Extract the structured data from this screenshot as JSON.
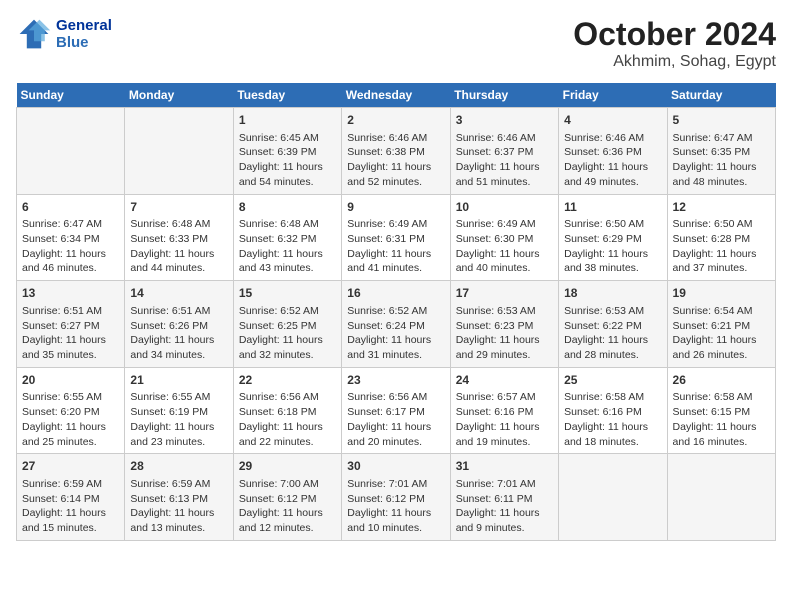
{
  "header": {
    "logo_line1": "General",
    "logo_line2": "Blue",
    "month": "October 2024",
    "location": "Akhmim, Sohag, Egypt"
  },
  "days_of_week": [
    "Sunday",
    "Monday",
    "Tuesday",
    "Wednesday",
    "Thursday",
    "Friday",
    "Saturday"
  ],
  "weeks": [
    [
      {
        "day": "",
        "content": ""
      },
      {
        "day": "",
        "content": ""
      },
      {
        "day": "1",
        "content": "Sunrise: 6:45 AM\nSunset: 6:39 PM\nDaylight: 11 hours and 54 minutes."
      },
      {
        "day": "2",
        "content": "Sunrise: 6:46 AM\nSunset: 6:38 PM\nDaylight: 11 hours and 52 minutes."
      },
      {
        "day": "3",
        "content": "Sunrise: 6:46 AM\nSunset: 6:37 PM\nDaylight: 11 hours and 51 minutes."
      },
      {
        "day": "4",
        "content": "Sunrise: 6:46 AM\nSunset: 6:36 PM\nDaylight: 11 hours and 49 minutes."
      },
      {
        "day": "5",
        "content": "Sunrise: 6:47 AM\nSunset: 6:35 PM\nDaylight: 11 hours and 48 minutes."
      }
    ],
    [
      {
        "day": "6",
        "content": "Sunrise: 6:47 AM\nSunset: 6:34 PM\nDaylight: 11 hours and 46 minutes."
      },
      {
        "day": "7",
        "content": "Sunrise: 6:48 AM\nSunset: 6:33 PM\nDaylight: 11 hours and 44 minutes."
      },
      {
        "day": "8",
        "content": "Sunrise: 6:48 AM\nSunset: 6:32 PM\nDaylight: 11 hours and 43 minutes."
      },
      {
        "day": "9",
        "content": "Sunrise: 6:49 AM\nSunset: 6:31 PM\nDaylight: 11 hours and 41 minutes."
      },
      {
        "day": "10",
        "content": "Sunrise: 6:49 AM\nSunset: 6:30 PM\nDaylight: 11 hours and 40 minutes."
      },
      {
        "day": "11",
        "content": "Sunrise: 6:50 AM\nSunset: 6:29 PM\nDaylight: 11 hours and 38 minutes."
      },
      {
        "day": "12",
        "content": "Sunrise: 6:50 AM\nSunset: 6:28 PM\nDaylight: 11 hours and 37 minutes."
      }
    ],
    [
      {
        "day": "13",
        "content": "Sunrise: 6:51 AM\nSunset: 6:27 PM\nDaylight: 11 hours and 35 minutes."
      },
      {
        "day": "14",
        "content": "Sunrise: 6:51 AM\nSunset: 6:26 PM\nDaylight: 11 hours and 34 minutes."
      },
      {
        "day": "15",
        "content": "Sunrise: 6:52 AM\nSunset: 6:25 PM\nDaylight: 11 hours and 32 minutes."
      },
      {
        "day": "16",
        "content": "Sunrise: 6:52 AM\nSunset: 6:24 PM\nDaylight: 11 hours and 31 minutes."
      },
      {
        "day": "17",
        "content": "Sunrise: 6:53 AM\nSunset: 6:23 PM\nDaylight: 11 hours and 29 minutes."
      },
      {
        "day": "18",
        "content": "Sunrise: 6:53 AM\nSunset: 6:22 PM\nDaylight: 11 hours and 28 minutes."
      },
      {
        "day": "19",
        "content": "Sunrise: 6:54 AM\nSunset: 6:21 PM\nDaylight: 11 hours and 26 minutes."
      }
    ],
    [
      {
        "day": "20",
        "content": "Sunrise: 6:55 AM\nSunset: 6:20 PM\nDaylight: 11 hours and 25 minutes."
      },
      {
        "day": "21",
        "content": "Sunrise: 6:55 AM\nSunset: 6:19 PM\nDaylight: 11 hours and 23 minutes."
      },
      {
        "day": "22",
        "content": "Sunrise: 6:56 AM\nSunset: 6:18 PM\nDaylight: 11 hours and 22 minutes."
      },
      {
        "day": "23",
        "content": "Sunrise: 6:56 AM\nSunset: 6:17 PM\nDaylight: 11 hours and 20 minutes."
      },
      {
        "day": "24",
        "content": "Sunrise: 6:57 AM\nSunset: 6:16 PM\nDaylight: 11 hours and 19 minutes."
      },
      {
        "day": "25",
        "content": "Sunrise: 6:58 AM\nSunset: 6:16 PM\nDaylight: 11 hours and 18 minutes."
      },
      {
        "day": "26",
        "content": "Sunrise: 6:58 AM\nSunset: 6:15 PM\nDaylight: 11 hours and 16 minutes."
      }
    ],
    [
      {
        "day": "27",
        "content": "Sunrise: 6:59 AM\nSunset: 6:14 PM\nDaylight: 11 hours and 15 minutes."
      },
      {
        "day": "28",
        "content": "Sunrise: 6:59 AM\nSunset: 6:13 PM\nDaylight: 11 hours and 13 minutes."
      },
      {
        "day": "29",
        "content": "Sunrise: 7:00 AM\nSunset: 6:12 PM\nDaylight: 11 hours and 12 minutes."
      },
      {
        "day": "30",
        "content": "Sunrise: 7:01 AM\nSunset: 6:12 PM\nDaylight: 11 hours and 10 minutes."
      },
      {
        "day": "31",
        "content": "Sunrise: 7:01 AM\nSunset: 6:11 PM\nDaylight: 11 hours and 9 minutes."
      },
      {
        "day": "",
        "content": ""
      },
      {
        "day": "",
        "content": ""
      }
    ]
  ]
}
